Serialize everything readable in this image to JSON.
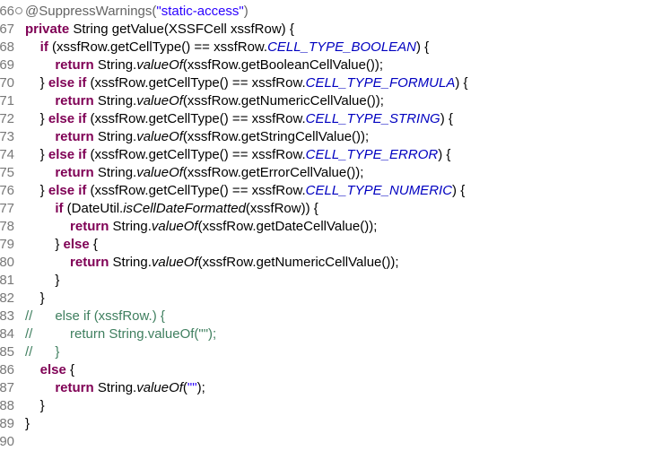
{
  "editor": {
    "lines": [
      {
        "num": "66",
        "segments": [
          {
            "t": "ann",
            "v": "@SuppressWarnings("
          },
          {
            "t": "str",
            "v": "\"static-access\""
          },
          {
            "t": "ann",
            "v": ")"
          }
        ],
        "fold": true
      },
      {
        "num": "67",
        "segments": [
          {
            "t": "kw",
            "v": "private"
          },
          {
            "t": "",
            "v": " String getValue(XSSFCell xssfRow) {"
          }
        ]
      },
      {
        "num": "68",
        "segments": [
          {
            "t": "",
            "v": "    "
          },
          {
            "t": "kw",
            "v": "if"
          },
          {
            "t": "",
            "v": " (xssfRow.getCellType() == xssfRow."
          },
          {
            "t": "cst",
            "v": "CELL_TYPE_BOOLEAN"
          },
          {
            "t": "",
            "v": ") {"
          }
        ]
      },
      {
        "num": "69",
        "segments": [
          {
            "t": "",
            "v": "        "
          },
          {
            "t": "kw",
            "v": "return"
          },
          {
            "t": "",
            "v": " String."
          },
          {
            "t": "it",
            "v": "valueOf"
          },
          {
            "t": "",
            "v": "(xssfRow.getBooleanCellValue());"
          }
        ]
      },
      {
        "num": "70",
        "segments": [
          {
            "t": "",
            "v": "    } "
          },
          {
            "t": "kw",
            "v": "else if"
          },
          {
            "t": "",
            "v": " (xssfRow.getCellType() == xssfRow."
          },
          {
            "t": "cst",
            "v": "CELL_TYPE_FORMULA"
          },
          {
            "t": "",
            "v": ") {"
          }
        ]
      },
      {
        "num": "71",
        "segments": [
          {
            "t": "",
            "v": "        "
          },
          {
            "t": "kw",
            "v": "return"
          },
          {
            "t": "",
            "v": " String."
          },
          {
            "t": "it",
            "v": "valueOf"
          },
          {
            "t": "",
            "v": "(xssfRow.getNumericCellValue());"
          }
        ]
      },
      {
        "num": "72",
        "segments": [
          {
            "t": "",
            "v": "    } "
          },
          {
            "t": "kw",
            "v": "else if"
          },
          {
            "t": "",
            "v": " (xssfRow.getCellType() == xssfRow."
          },
          {
            "t": "cst",
            "v": "CELL_TYPE_STRING"
          },
          {
            "t": "",
            "v": ") {"
          }
        ]
      },
      {
        "num": "73",
        "segments": [
          {
            "t": "",
            "v": "        "
          },
          {
            "t": "kw",
            "v": "return"
          },
          {
            "t": "",
            "v": " String."
          },
          {
            "t": "it",
            "v": "valueOf"
          },
          {
            "t": "",
            "v": "(xssfRow.getStringCellValue());"
          }
        ]
      },
      {
        "num": "74",
        "segments": [
          {
            "t": "",
            "v": "    } "
          },
          {
            "t": "kw",
            "v": "else if"
          },
          {
            "t": "",
            "v": " (xssfRow.getCellType() == xssfRow."
          },
          {
            "t": "cst",
            "v": "CELL_TYPE_ERROR"
          },
          {
            "t": "",
            "v": ") {"
          }
        ]
      },
      {
        "num": "75",
        "segments": [
          {
            "t": "",
            "v": "        "
          },
          {
            "t": "kw",
            "v": "return"
          },
          {
            "t": "",
            "v": " String."
          },
          {
            "t": "it",
            "v": "valueOf"
          },
          {
            "t": "",
            "v": "(xssfRow.getErrorCellValue());"
          }
        ]
      },
      {
        "num": "76",
        "segments": [
          {
            "t": "",
            "v": "    } "
          },
          {
            "t": "kw",
            "v": "else if"
          },
          {
            "t": "",
            "v": " (xssfRow.getCellType() == xssfRow."
          },
          {
            "t": "cst",
            "v": "CELL_TYPE_NUMERIC"
          },
          {
            "t": "",
            "v": ") {"
          }
        ]
      },
      {
        "num": "77",
        "segments": [
          {
            "t": "",
            "v": "        "
          },
          {
            "t": "kw",
            "v": "if"
          },
          {
            "t": "",
            "v": " (DateUtil."
          },
          {
            "t": "it",
            "v": "isCellDateFormatted"
          },
          {
            "t": "",
            "v": "(xssfRow)) {"
          }
        ]
      },
      {
        "num": "78",
        "segments": [
          {
            "t": "",
            "v": "            "
          },
          {
            "t": "kw",
            "v": "return"
          },
          {
            "t": "",
            "v": " String."
          },
          {
            "t": "it",
            "v": "valueOf"
          },
          {
            "t": "",
            "v": "(xssfRow.getDateCellValue());"
          }
        ]
      },
      {
        "num": "79",
        "segments": [
          {
            "t": "",
            "v": "        } "
          },
          {
            "t": "kw",
            "v": "else"
          },
          {
            "t": "",
            "v": " {"
          }
        ]
      },
      {
        "num": "80",
        "segments": [
          {
            "t": "",
            "v": "            "
          },
          {
            "t": "kw",
            "v": "return"
          },
          {
            "t": "",
            "v": " String."
          },
          {
            "t": "it",
            "v": "valueOf"
          },
          {
            "t": "",
            "v": "(xssfRow.getNumericCellValue());"
          }
        ]
      },
      {
        "num": "81",
        "segments": [
          {
            "t": "",
            "v": "        }"
          }
        ]
      },
      {
        "num": "82",
        "segments": [
          {
            "t": "",
            "v": "    }"
          }
        ]
      },
      {
        "num": "83",
        "segments": [
          {
            "t": "cm",
            "v": "//      else if (xssfRow.) {"
          }
        ]
      },
      {
        "num": "84",
        "segments": [
          {
            "t": "cm",
            "v": "//          return String.valueOf(\"\");"
          }
        ]
      },
      {
        "num": "85",
        "segments": [
          {
            "t": "cm",
            "v": "//      }"
          }
        ]
      },
      {
        "num": "86",
        "segments": [
          {
            "t": "",
            "v": "    "
          },
          {
            "t": "kw",
            "v": "else"
          },
          {
            "t": "",
            "v": " {"
          }
        ]
      },
      {
        "num": "87",
        "segments": [
          {
            "t": "",
            "v": "        "
          },
          {
            "t": "kw",
            "v": "return"
          },
          {
            "t": "",
            "v": " String."
          },
          {
            "t": "it",
            "v": "valueOf"
          },
          {
            "t": "",
            "v": "("
          },
          {
            "t": "str",
            "v": "\"\""
          },
          {
            "t": "",
            "v": ");"
          }
        ]
      },
      {
        "num": "88",
        "segments": [
          {
            "t": "",
            "v": "    }"
          }
        ]
      },
      {
        "num": "89",
        "segments": [
          {
            "t": "",
            "v": "}"
          }
        ]
      },
      {
        "num": "90",
        "segments": []
      }
    ]
  }
}
